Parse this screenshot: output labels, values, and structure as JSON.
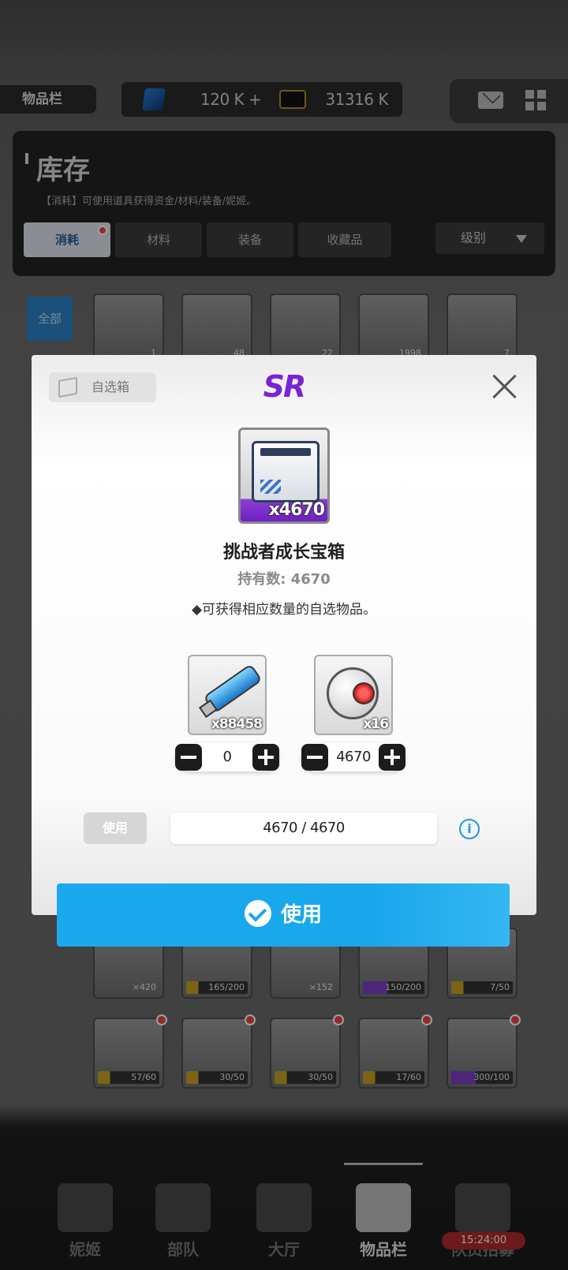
{
  "topbar": {
    "section_label": "物品栏",
    "gems_value": "120 K +",
    "credits_value": "31316 K",
    "icons": [
      "gem-icon",
      "chip-icon",
      "mail-icon",
      "grid-menu-icon"
    ]
  },
  "inventory": {
    "title": "库存",
    "description": "【消耗】可使用道具获得资金/材料/装备/妮姬。",
    "tabs": [
      {
        "label": "消耗",
        "active": true
      },
      {
        "label": "材料",
        "active": false
      },
      {
        "label": "装备",
        "active": false
      },
      {
        "label": "收藏品",
        "active": false
      }
    ],
    "sort_label": "级别",
    "filter_all": "全部",
    "row1_counts": [
      "1",
      "48",
      "22",
      "1998",
      "7"
    ],
    "row2": [
      {
        "count": "×420"
      },
      {
        "progress": "165/200"
      },
      {
        "count": "×152"
      },
      {
        "progress": "150/200"
      },
      {
        "progress": "7/50"
      }
    ],
    "row3": [
      {
        "progress": "57/60"
      },
      {
        "progress": "30/50"
      },
      {
        "progress": "30/50"
      },
      {
        "progress": "17/60"
      },
      {
        "progress": "300/100"
      }
    ]
  },
  "modal": {
    "select_chip": "自选箱",
    "rarity": "SR",
    "item_qty": "x4670",
    "item_name": "挑战者成长宝箱",
    "owned": "持有数: 4670",
    "description": "◆可获得相应数量的自选物品。",
    "choices": [
      {
        "qty": "x88458",
        "value": "0",
        "icon": "usb-drive-icon"
      },
      {
        "qty": "x16",
        "value": "4670",
        "icon": "droid-head-icon"
      }
    ],
    "use_small_label": "使用",
    "usage_progress": "4670 / 4670",
    "info_icon": "i",
    "use_button_label": "使用"
  },
  "nav": {
    "items": [
      {
        "label": "妮姬",
        "active": false
      },
      {
        "label": "部队",
        "active": false
      },
      {
        "label": "大厅",
        "active": false
      },
      {
        "label": "物品栏",
        "active": true
      },
      {
        "label": "队员招募",
        "active": false
      }
    ],
    "timer": "15:24:00"
  },
  "colors": {
    "accent_blue": "#1aa9ee",
    "rarity_purple": "#7a22d8"
  }
}
